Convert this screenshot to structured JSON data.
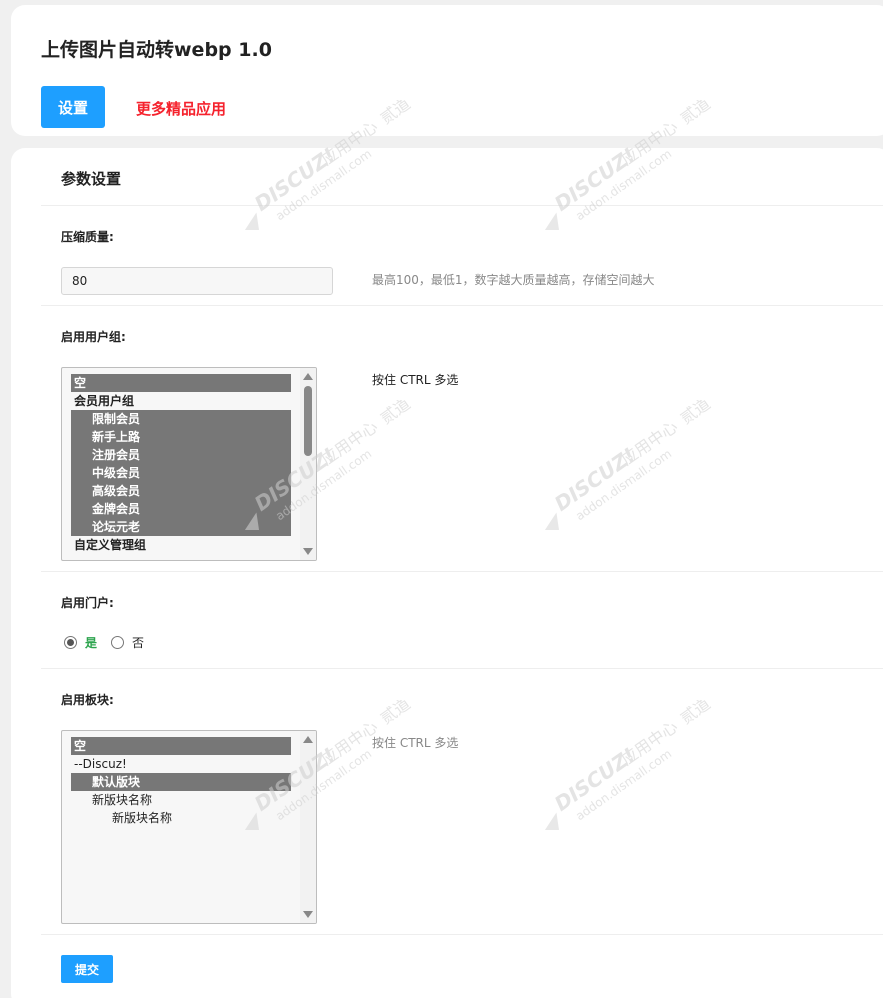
{
  "header": {
    "title": "上传图片自动转webp 1.0",
    "settings_label": "设置",
    "more_apps_label": "更多精品应用"
  },
  "section": {
    "title": "参数设置"
  },
  "compress": {
    "label": "压缩质量:",
    "value": "80",
    "hint": "最高100，最低1，数字越大质量越高，存储空间越大"
  },
  "user_groups": {
    "label": "启用用户组:",
    "hint": "按住 CTRL 多选",
    "options": [
      {
        "label": "空",
        "selected": true,
        "level": 1
      },
      {
        "label": "会员用户组",
        "selected": false,
        "level": 1,
        "group": true
      },
      {
        "label": "限制会员",
        "selected": true,
        "level": 2
      },
      {
        "label": "新手上路",
        "selected": true,
        "level": 2
      },
      {
        "label": "注册会员",
        "selected": true,
        "level": 2
      },
      {
        "label": "中级会员",
        "selected": true,
        "level": 2
      },
      {
        "label": "高级会员",
        "selected": true,
        "level": 2
      },
      {
        "label": "金牌会员",
        "selected": true,
        "level": 2
      },
      {
        "label": "论坛元老",
        "selected": true,
        "level": 2
      },
      {
        "label": "自定义管理组",
        "selected": false,
        "level": 1,
        "group": true
      }
    ]
  },
  "portal": {
    "label": "启用门户:",
    "yes_label": "是",
    "no_label": "否",
    "selected": "yes"
  },
  "forums": {
    "label": "启用板块:",
    "hint": "按住 CTRL 多选",
    "options": [
      {
        "label": "空",
        "selected": true,
        "level": 1
      },
      {
        "label": "--Discuz!",
        "selected": false,
        "level": 1
      },
      {
        "label": "默认版块",
        "selected": true,
        "level": 2
      },
      {
        "label": "新版块名称",
        "selected": false,
        "level": 2
      },
      {
        "label": "新版块名称",
        "selected": false,
        "level": 3
      }
    ]
  },
  "submit_label": "提交",
  "watermark": {
    "brand": "DISCUZ!",
    "center": "应用中心",
    "partner": "贰道",
    "domain": "addon.dismall.com"
  }
}
